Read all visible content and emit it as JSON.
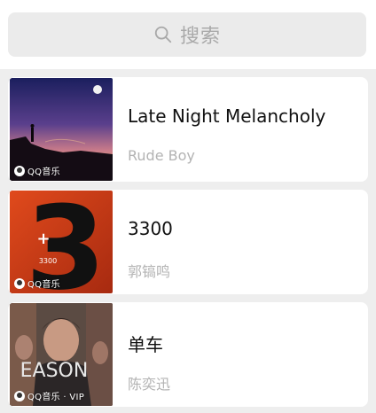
{
  "search": {
    "placeholder": "搜索"
  },
  "songs": [
    {
      "title": "Late Night Melancholy",
      "artist": "Rude Boy",
      "badge": "QQ音乐"
    },
    {
      "title": "3300",
      "artist": "郭镐鸣",
      "badge": "QQ音乐"
    },
    {
      "title": "单车",
      "artist": "陈奕迅",
      "badge": "QQ音乐 · VIP"
    }
  ],
  "cover_text": {
    "numeral": "3",
    "plus": "+",
    "value": "3300",
    "eason": "EASON"
  },
  "colors": {
    "background": "#eeeeee",
    "card": "#ffffff",
    "search_bar": "#ebebeb",
    "placeholder": "#a9a9a9",
    "title": "#111111",
    "artist": "#b3b3b3"
  }
}
